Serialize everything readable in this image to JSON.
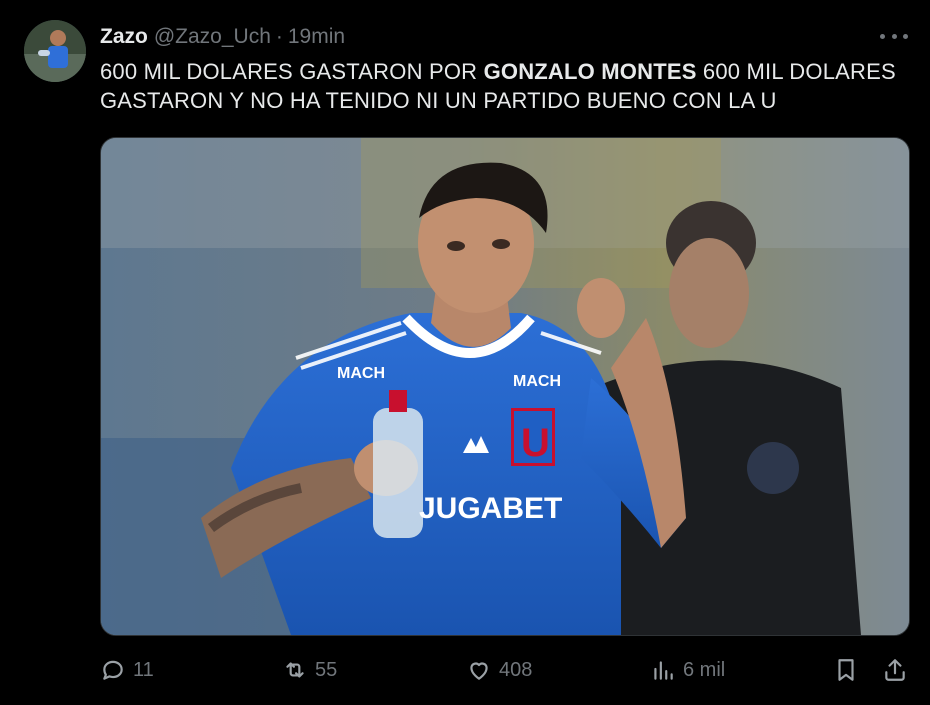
{
  "author": {
    "display_name": "Zazo",
    "handle": "@Zazo_Uch",
    "separator": "·",
    "time": "19min"
  },
  "tweet": {
    "text_part1": "600 MIL DOLARES GASTARON POR ",
    "text_bold": "GONZALO MONTES",
    "text_part2": " 600 MIL DOLARES GASTARON Y NO HA TENIDO NI UN PARTIDO BUENO CON LA U"
  },
  "media": {
    "jersey_sponsor_top": "MACH",
    "jersey_sponsor_left": "MACH",
    "jersey_crest": "U",
    "jersey_sponsor_main": "JUGABET"
  },
  "actions": {
    "replies": "11",
    "reposts": "55",
    "likes": "408",
    "views": "6 mil"
  },
  "icons": {
    "reply": "reply-icon",
    "repost": "repost-icon",
    "like": "heart-icon",
    "views": "views-chart-icon",
    "bookmark": "bookmark-icon",
    "share": "share-icon",
    "more": "more-dots-icon"
  },
  "colors": {
    "background": "#000000",
    "text_primary": "#e7e9ea",
    "text_secondary": "#71767b",
    "jersey_blue": "#1f5fc4",
    "crest_red": "#c8102e"
  }
}
